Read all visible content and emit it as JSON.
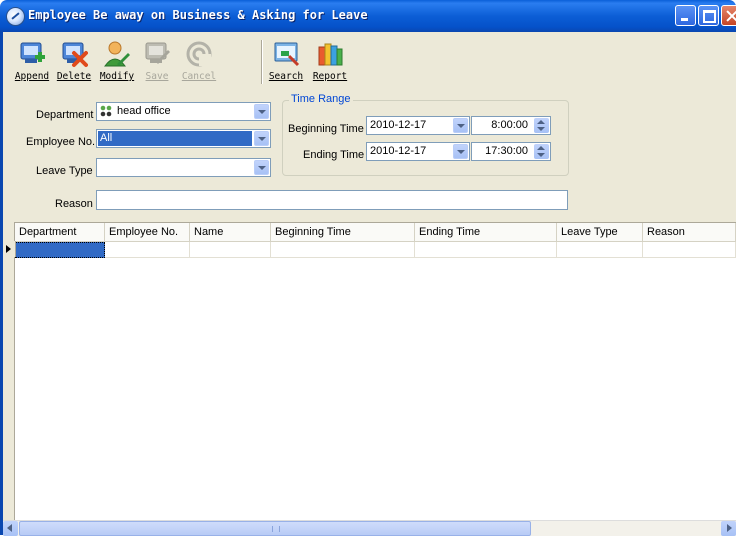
{
  "window": {
    "title": "Employee Be away on Business & Asking for Leave"
  },
  "toolbar": {
    "buttons": [
      {
        "label": "Append",
        "icon": "append-icon",
        "enabled": true
      },
      {
        "label": "Delete",
        "icon": "delete-icon",
        "enabled": true
      },
      {
        "label": "Modify",
        "icon": "modify-icon",
        "enabled": true
      },
      {
        "label": "Save",
        "icon": "save-icon",
        "enabled": false
      },
      {
        "label": "Cancel",
        "icon": "cancel-icon",
        "enabled": false
      },
      {
        "label": "Search",
        "icon": "search-icon",
        "enabled": true
      },
      {
        "label": "Report",
        "icon": "report-icon",
        "enabled": true
      }
    ]
  },
  "form": {
    "department_label": "Department",
    "department_value": "head office",
    "employee_label": "Employee No.",
    "employee_value": "All",
    "leave_type_label": "Leave Type",
    "leave_type_value": "",
    "reason_label": "Reason",
    "reason_value": "",
    "time_range": {
      "title": "Time Range",
      "beginning_label": "Beginning Time",
      "beginning_date": "2010-12-17",
      "beginning_time": "8:00:00",
      "ending_label": "Ending Time",
      "ending_date": "2010-12-17",
      "ending_time": "17:30:00"
    }
  },
  "grid": {
    "columns": [
      "Department",
      "Employee No.",
      "Name",
      "Beginning Time",
      "Ending Time",
      "Leave Type",
      "Reason"
    ],
    "rows": []
  },
  "colors": {
    "titlebar": "#0a5fd8",
    "window_bg": "#ece9d8",
    "selection": "#316ac5",
    "group_title": "#0046d5"
  }
}
